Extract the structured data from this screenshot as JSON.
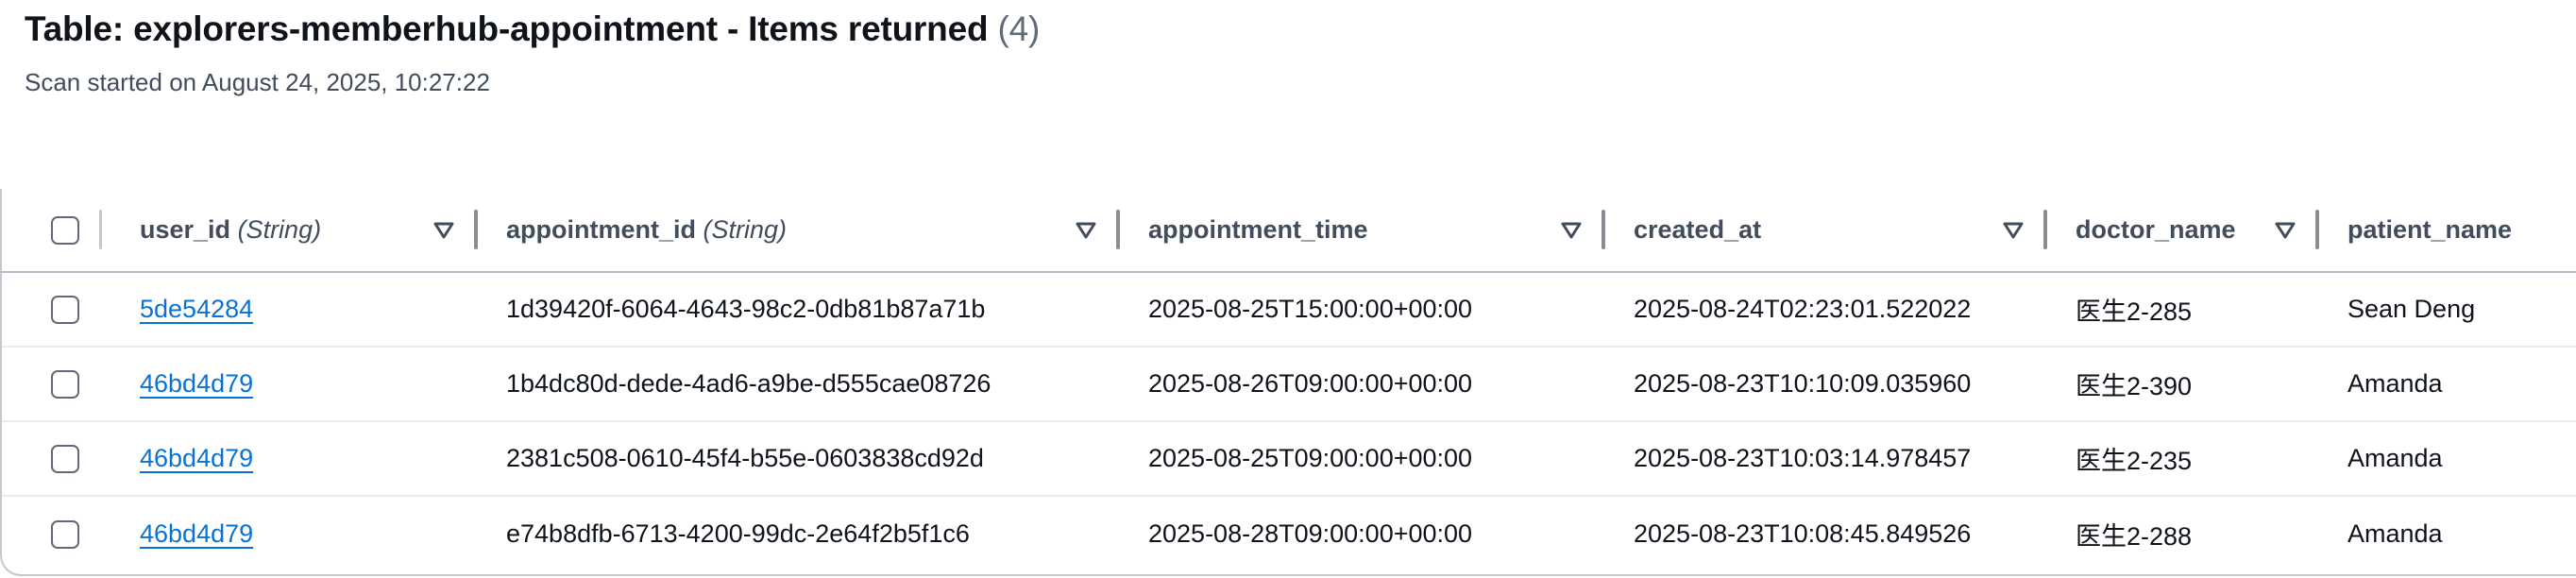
{
  "header": {
    "title": "Table: explorers-memberhub-appointment - Items returned",
    "count": "(4)",
    "subtitle": "Scan started on August 24, 2025, 10:27:22"
  },
  "table": {
    "columns": [
      {
        "name": "user_id",
        "type": "(String)"
      },
      {
        "name": "appointment_id",
        "type": "(String)"
      },
      {
        "name": "appointment_time",
        "type": ""
      },
      {
        "name": "created_at",
        "type": ""
      },
      {
        "name": "doctor_name",
        "type": ""
      },
      {
        "name": "patient_name",
        "type": ""
      }
    ],
    "rows": [
      {
        "user_id": "5de54284",
        "appointment_id": "1d39420f-6064-4643-98c2-0db81b87a71b",
        "appointment_time": "2025-08-25T15:00:00+00:00",
        "created_at": "2025-08-24T02:23:01.522022",
        "doctor_name": "医生2-285",
        "patient_name": "Sean Deng"
      },
      {
        "user_id": "46bd4d79",
        "appointment_id": "1b4dc80d-dede-4ad6-a9be-d555cae08726",
        "appointment_time": "2025-08-26T09:00:00+00:00",
        "created_at": "2025-08-23T10:10:09.035960",
        "doctor_name": "医生2-390",
        "patient_name": "Amanda"
      },
      {
        "user_id": "46bd4d79",
        "appointment_id": "2381c508-0610-45f4-b55e-0603838cd92d",
        "appointment_time": "2025-08-25T09:00:00+00:00",
        "created_at": "2025-08-23T10:03:14.978457",
        "doctor_name": "医生2-235",
        "patient_name": "Amanda"
      },
      {
        "user_id": "46bd4d79",
        "appointment_id": "e74b8dfb-6713-4200-99dc-2e64f2b5f1c6",
        "appointment_time": "2025-08-28T09:00:00+00:00",
        "created_at": "2025-08-23T10:08:45.849526",
        "doctor_name": "医生2-288",
        "patient_name": "Amanda"
      }
    ]
  },
  "icons": {
    "sort": "sort-down-triangle-icon",
    "checkbox": "checkbox-unchecked"
  },
  "colors": {
    "link": "#0972d3",
    "header_text": "#414d5c",
    "divider": "#8c8c94"
  }
}
